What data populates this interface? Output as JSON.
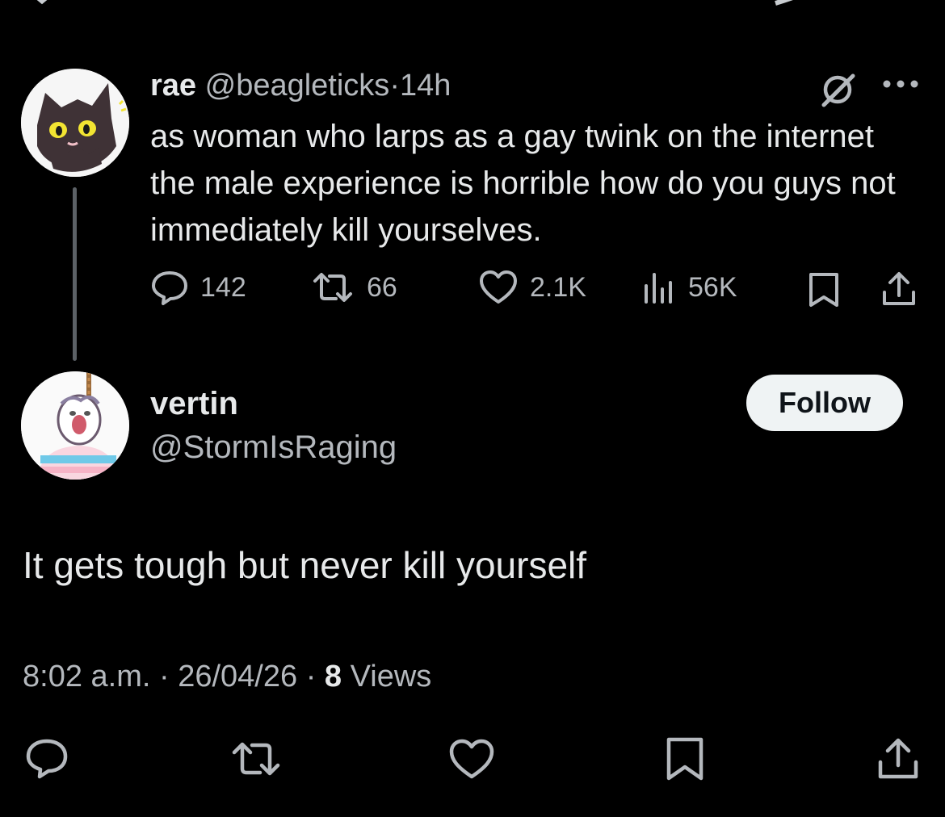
{
  "parent_tweet": {
    "display_name": "rae",
    "handle": "@beagleticks",
    "separator": "·",
    "time": "14h",
    "text": "as woman who larps as a gay twink on the internet the male experience is horrible how do you guys not immediately kill yourselves.",
    "replies": "142",
    "reposts": "66",
    "likes": "2.1K",
    "views": "56K",
    "icons": [
      "grok-icon",
      "more-icon",
      "reply-icon",
      "repost-icon",
      "like-icon",
      "views-icon",
      "bookmark-icon",
      "share-icon"
    ]
  },
  "reply_tweet": {
    "display_name": "vertin",
    "handle": "@StormIsRaging",
    "follow_label": "Follow",
    "text": "It gets tough but never kill yourself",
    "time": "8:02 a.m.",
    "date": "26/04/26",
    "dot": "·",
    "views_count": "8",
    "views_label": "Views",
    "icons": [
      "reply-icon",
      "repost-icon",
      "like-icon",
      "bookmark-icon",
      "share-icon"
    ]
  },
  "colors": {
    "background": "#000000",
    "text": "#e7e9ea",
    "muted": "#b4b8bd",
    "thread_line": "#5c6166",
    "follow_bg": "#eff3f4"
  }
}
